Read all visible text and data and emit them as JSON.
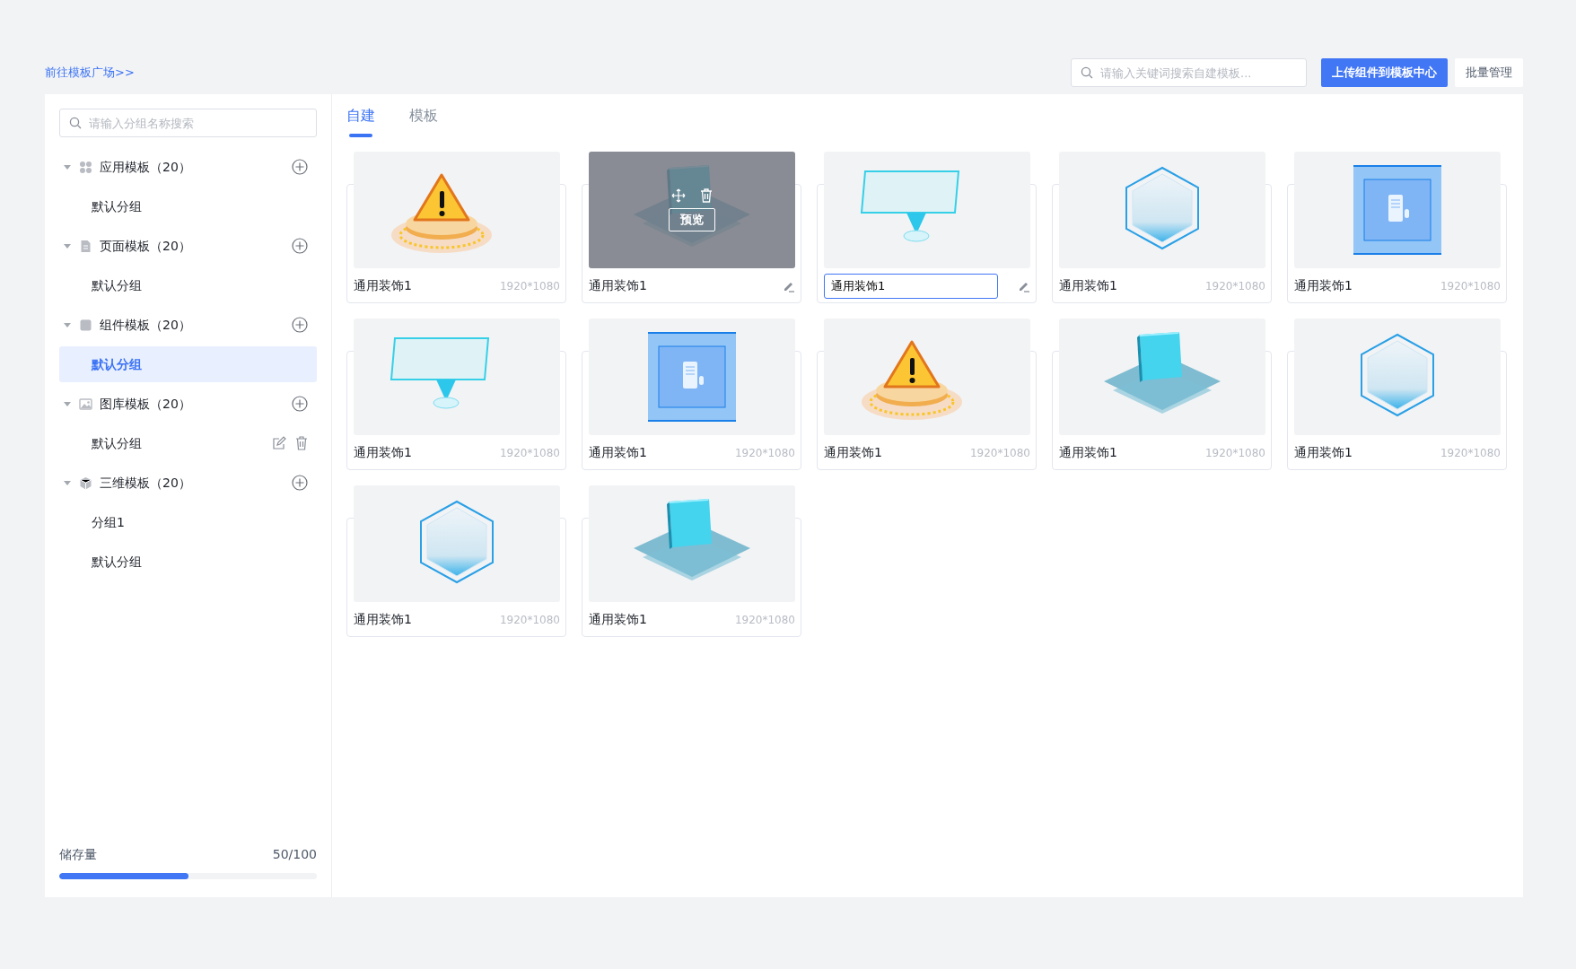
{
  "link": "前往模板广场>>",
  "search": {
    "placeholder": "请输入关键词搜索自建模板..."
  },
  "buttons": [
    {
      "label": "上传组件到模板中心",
      "kind": "primary"
    },
    {
      "label": "批量管理",
      "kind": "secondary"
    }
  ],
  "sidebar": {
    "search": {
      "placeholder": "请输入分组名称搜索"
    },
    "groups": [
      {
        "kind": "apps",
        "label": "应用模板（20）",
        "expanded": true,
        "children": [
          {
            "label": "默认分组",
            "selected": false,
            "actions": false
          }
        ]
      },
      {
        "kind": "page",
        "label": "页面模板（20）",
        "expanded": true,
        "children": [
          {
            "label": "默认分组",
            "selected": false,
            "actions": false
          }
        ]
      },
      {
        "kind": "component",
        "label": "组件模板（20）",
        "expanded": true,
        "children": [
          {
            "label": "默认分组",
            "selected": true,
            "actions": false
          }
        ]
      },
      {
        "kind": "gallery",
        "label": "图库模板（20）",
        "expanded": true,
        "children": [
          {
            "label": "默认分组",
            "selected": false,
            "actions": true
          }
        ]
      },
      {
        "kind": "cube",
        "label": "三维模板（20）",
        "expanded": true,
        "children": [
          {
            "label": "分组1",
            "selected": false,
            "actions": false
          },
          {
            "label": "默认分组",
            "selected": false,
            "actions": false
          }
        ]
      }
    ],
    "storage": {
      "label": "储存量",
      "reading": "50/100",
      "level": 0.5
    }
  },
  "tabs": [
    {
      "label": "自建",
      "selected": true
    },
    {
      "label": "模板",
      "selected": false
    }
  ],
  "cards": [
    {
      "kind": "warning",
      "name": "通用装饰1",
      "size": "1920*1080",
      "hovered": false,
      "editing": false
    },
    {
      "kind": "cube",
      "name": "通用装饰1",
      "hovered": true,
      "editing": false,
      "preview": "预览"
    },
    {
      "kind": "screen",
      "name": "通用装饰1",
      "hovered": false,
      "editing": true
    },
    {
      "kind": "hexagon",
      "name": "通用装饰1",
      "size": "1920*1080",
      "hovered": false,
      "editing": false
    },
    {
      "kind": "building",
      "name": "通用装饰1",
      "size": "1920*1080",
      "hovered": false,
      "editing": false
    },
    {
      "kind": "screen",
      "name": "通用装饰1",
      "size": "1920*1080",
      "hovered": false,
      "editing": false
    },
    {
      "kind": "building",
      "name": "通用装饰1",
      "size": "1920*1080",
      "hovered": false,
      "editing": false
    },
    {
      "kind": "warning",
      "name": "通用装饰1",
      "size": "1920*1080",
      "hovered": false,
      "editing": false
    },
    {
      "kind": "cube",
      "name": "通用装饰1",
      "size": "1920*1080",
      "hovered": false,
      "editing": false
    },
    {
      "kind": "hexagon",
      "name": "通用装饰1",
      "size": "1920*1080",
      "hovered": false,
      "editing": false
    },
    {
      "kind": "hexagon",
      "name": "通用装饰1",
      "size": "1920*1080",
      "hovered": false,
      "editing": false
    },
    {
      "kind": "cube",
      "name": "通用装饰1",
      "size": "1920*1080",
      "hovered": false,
      "editing": false
    }
  ]
}
